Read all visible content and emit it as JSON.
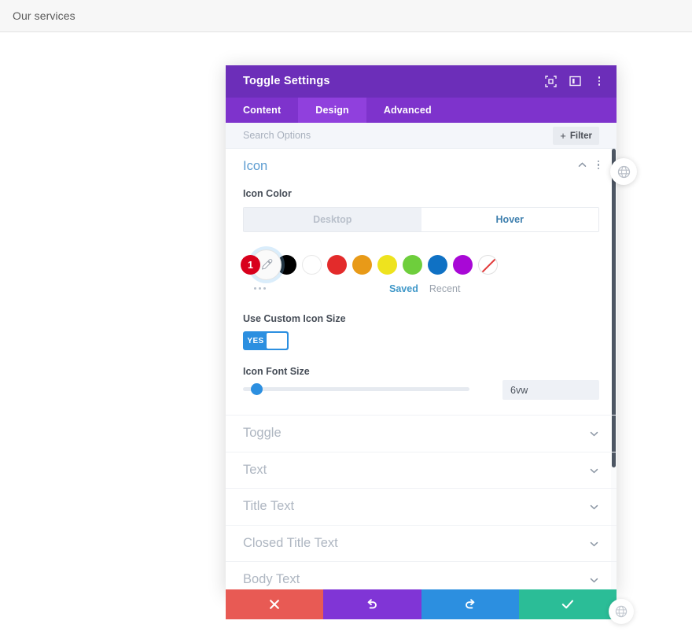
{
  "page": {
    "header_title": "Our services"
  },
  "modal": {
    "title": "Toggle Settings",
    "titlebar_icons": [
      {
        "name": "fullscreen-icon"
      },
      {
        "name": "layout-panel-icon"
      },
      {
        "name": "kebab-menu-icon"
      }
    ],
    "tabs": [
      {
        "label": "Content",
        "active": false
      },
      {
        "label": "Design",
        "active": true
      },
      {
        "label": "Advanced",
        "active": false
      }
    ],
    "search": {
      "placeholder": "Search Options",
      "value": ""
    },
    "filter_button": {
      "label": "Filter",
      "plus": "+"
    },
    "icon_section": {
      "title": "Icon",
      "collapse_icon": "chevron-up-icon",
      "menu_icon": "kebab-menu-icon",
      "icon_color_label": "Icon Color",
      "state_tabs": [
        {
          "label": "Desktop",
          "active": false
        },
        {
          "label": "Hover",
          "active": true
        }
      ],
      "swatch_badge": "1",
      "swatches": [
        {
          "name": "black",
          "hex": "#000000"
        },
        {
          "name": "white",
          "hex": "#ffffff"
        },
        {
          "name": "red",
          "hex": "#e32b2b"
        },
        {
          "name": "orange",
          "hex": "#e89a18"
        },
        {
          "name": "yellow",
          "hex": "#eee31e"
        },
        {
          "name": "green",
          "hex": "#6ece3c"
        },
        {
          "name": "blue",
          "hex": "#0f71c4"
        },
        {
          "name": "purple",
          "hex": "#a808d6"
        }
      ],
      "no-color-swatch": "transparent-none",
      "more_label": "more-options",
      "saved_label": "Saved",
      "recent_label": "Recent",
      "custom_size_label": "Use Custom Icon Size",
      "custom_size_toggle": "YES",
      "font_size_label": "Icon Font Size",
      "font_size_value": "6vw",
      "font_size_percent": 4
    },
    "collapsed_sections": [
      {
        "label": "Toggle"
      },
      {
        "label": "Text"
      },
      {
        "label": "Title Text"
      },
      {
        "label": "Closed Title Text"
      },
      {
        "label": "Body Text"
      }
    ],
    "footer_buttons": [
      {
        "name": "cancel",
        "icon": "close-icon",
        "color": "#e85a54"
      },
      {
        "name": "undo",
        "icon": "undo-icon",
        "color": "#8035d6"
      },
      {
        "name": "redo",
        "icon": "redo-icon",
        "color": "#2c8fe0"
      },
      {
        "name": "save",
        "icon": "check-icon",
        "color": "#2bbd97"
      }
    ]
  },
  "colors": {
    "titlebar": "#6c2eb9",
    "tabbar": "#7e33cc",
    "tab_active": "#9040dd",
    "accent_blue": "#2c8fe0",
    "section_title": "#5e9dd1"
  }
}
